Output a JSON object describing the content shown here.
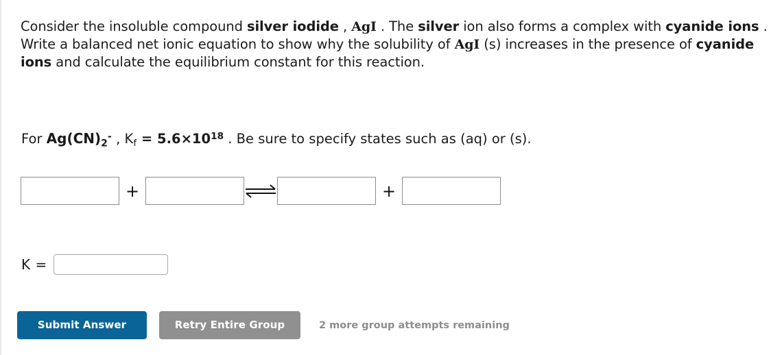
{
  "question": {
    "line1_a": "Consider the insoluble compound ",
    "bold1": "silver iodide",
    "line1_b": " , ",
    "chem1": "AgI",
    "line1_c": " . The ",
    "bold2": "silver",
    "line1_d": " ion also forms a complex with ",
    "bold3": "cyanide ions",
    "line1_e": " . Write a balanced net ionic equation to show why the solubility of ",
    "chem2": "AgI",
    "line1_f": " (s) increases in the presence of ",
    "bold4": "cyanide ions",
    "line1_g": " and calculate the equilibrium constant for this reaction."
  },
  "kf": {
    "for_label": "For ",
    "complex_base": "Ag(CN)",
    "complex_sub": "2",
    "complex_charge": "-",
    "comma": " , ",
    "k_symbol": "K",
    "k_subscript": "f",
    "equals": " = ",
    "value": "5.6×10",
    "exponent": "18",
    "tail": " . Be sure to specify states such as (aq) or (s)."
  },
  "equation": {
    "boxes": [
      {
        "value": "",
        "placeholder": ""
      },
      {
        "value": "",
        "placeholder": ""
      },
      {
        "value": "",
        "placeholder": ""
      },
      {
        "value": "",
        "placeholder": ""
      }
    ],
    "plus_symbol": "+",
    "arrow_symbol": "equilibrium-arrow"
  },
  "k_answer": {
    "label": "K =",
    "value": "",
    "placeholder": ""
  },
  "actions": {
    "submit_label": "Submit Answer",
    "retry_label": "Retry Entire Group",
    "attempts_text": "2 more group attempts remaining"
  },
  "colors": {
    "submit_blue": "#0b6497",
    "retry_gray": "#909090",
    "attempts_gray": "#8d8d8d",
    "box_border": "#8c8c8c"
  }
}
